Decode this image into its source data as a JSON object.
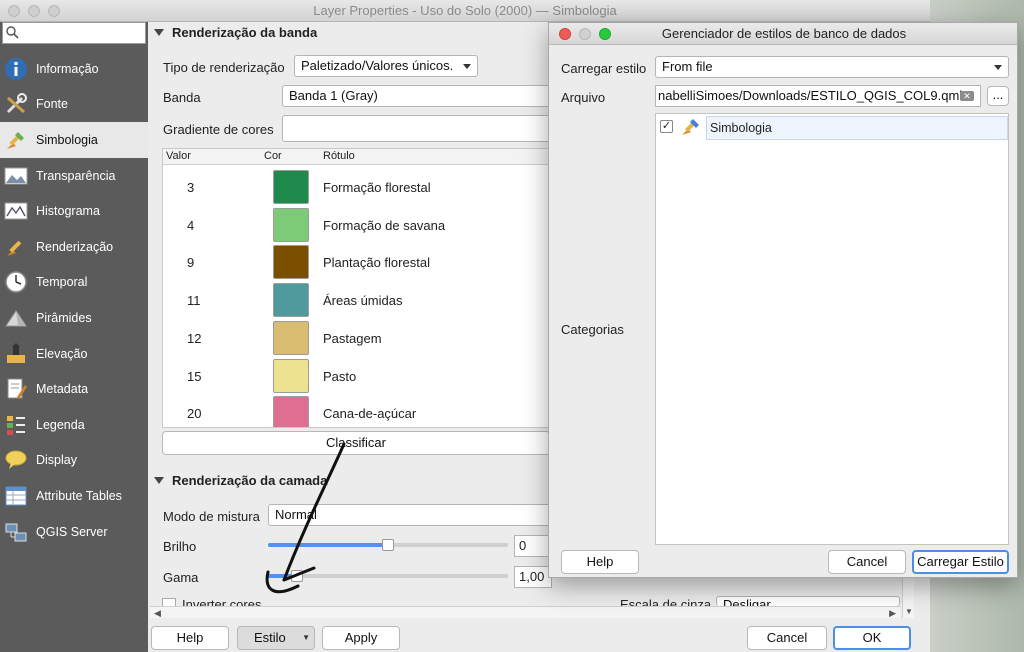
{
  "main_window": {
    "title": "Layer Properties - Uso do Solo (2000) — Simbologia",
    "search_placeholder": ""
  },
  "sidebar": {
    "items": [
      {
        "label": "Informação",
        "icon": "info-icon"
      },
      {
        "label": "Fonte",
        "icon": "tools-icon"
      },
      {
        "label": "Simbologia",
        "icon": "paintbrush-icon",
        "active": true
      },
      {
        "label": "Transparência",
        "icon": "transparency-icon"
      },
      {
        "label": "Histograma",
        "icon": "histogram-icon"
      },
      {
        "label": "Renderização",
        "icon": "brush-icon"
      },
      {
        "label": "Temporal",
        "icon": "clock-icon"
      },
      {
        "label": "Pirâmides",
        "icon": "pyramid-icon"
      },
      {
        "label": "Elevação",
        "icon": "elevation-icon"
      },
      {
        "label": "Metadata",
        "icon": "metadata-icon"
      },
      {
        "label": "Legenda",
        "icon": "legend-icon"
      },
      {
        "label": "Display",
        "icon": "speech-bubble-icon"
      },
      {
        "label": "Attribute Tables",
        "icon": "table-icon"
      },
      {
        "label": "QGIS Server",
        "icon": "server-icon"
      }
    ]
  },
  "band_rendering": {
    "section_title": "Renderização da banda",
    "render_type_label": "Tipo de renderização",
    "render_type_value": "Paletizado/Valores únicos.",
    "band_label": "Banda",
    "band_value": "Banda 1 (Gray)",
    "gradient_label": "Gradiente de cores",
    "table_headers": {
      "value": "Valor",
      "color": "Cor",
      "label": "Rótulo"
    },
    "classes": [
      {
        "value": "3",
        "color": "#1f8a4c",
        "label": "Formação florestal"
      },
      {
        "value": "4",
        "color": "#7dcb76",
        "label": "Formação de savana"
      },
      {
        "value": "9",
        "color": "#7a4f00",
        "label": "Plantação florestal"
      },
      {
        "value": "11",
        "color": "#4e9a9c",
        "label": "Áreas úmidas"
      },
      {
        "value": "12",
        "color": "#d9bd73",
        "label": "Pastagem"
      },
      {
        "value": "15",
        "color": "#ece28f",
        "label": "Pasto"
      },
      {
        "value": "20",
        "color": "#df6f92",
        "label": "Cana-de-açúcar"
      }
    ],
    "classify_label": "Classificar"
  },
  "layer_rendering": {
    "section_title": "Renderização da camada",
    "blend_label": "Modo de mistura",
    "blend_value": "Normal",
    "brightness_label": "Brilho",
    "brightness_value": "0",
    "brightness_level": 0.5,
    "gamma_label": "Gama",
    "gamma_value": "1,00",
    "gamma_level": 0.1,
    "invert_label": "Inverter cores",
    "zoom_label": "Escala de cinza",
    "zoom_value": "Desligar"
  },
  "bottom_buttons": {
    "help": "Help",
    "style": "Estilo",
    "apply": "Apply",
    "cancel": "Cancel",
    "ok": "OK"
  },
  "style_dialog": {
    "title": "Gerenciador de estilos de banco de dados",
    "load_style_label": "Carregar estilo",
    "load_style_value": "From file",
    "file_label": "Arquivo",
    "file_value": "nabelliSimoes/Downloads/ESTILO_QGIS_COL9.qml",
    "browse_label": "...",
    "categories_label": "Categorias",
    "category_item": "Simbologia",
    "help": "Help",
    "cancel": "Cancel",
    "load": "Carregar Estilo"
  },
  "colors": {
    "accent": "#4b8ee8",
    "sidebar_bg": "#5b5b5b",
    "close": "#ee5c55",
    "minimize": "#d0d0d0",
    "maximize": "#28c840"
  }
}
